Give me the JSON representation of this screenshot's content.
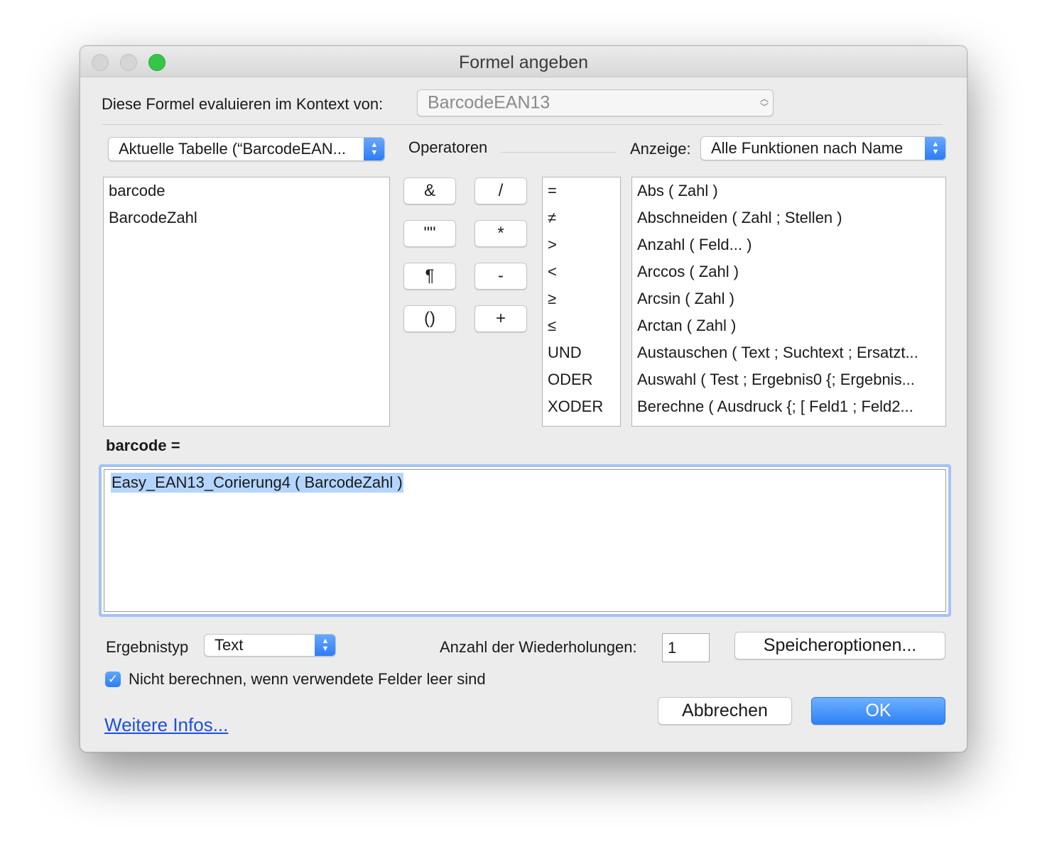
{
  "window": {
    "title": "Formel angeben"
  },
  "context": {
    "label": "Diese Formel evaluieren im Kontext von:",
    "value": "BarcodeEAN13"
  },
  "table_popup": {
    "value": "Aktuelle Tabelle (“BarcodeEAN..."
  },
  "operators_label": "Operatoren",
  "display": {
    "label": "Anzeige:",
    "value": "Alle Funktionen nach Name"
  },
  "fields": [
    "barcode",
    "BarcodeZahl"
  ],
  "operator_buttons": [
    "&",
    "/",
    "\"\"",
    "*",
    "¶",
    "-",
    "()",
    "+"
  ],
  "comparison_operators": [
    "=",
    "≠",
    ">",
    "<",
    "≥",
    "≤",
    "UND",
    "ODER",
    "XODER"
  ],
  "functions": [
    "Abs ( Zahl )",
    "Abschneiden ( Zahl ; Stellen )",
    "Anzahl ( Feld... )",
    "Arccos ( Zahl )",
    "Arcsin ( Zahl )",
    "Arctan ( Zahl )",
    "Austauschen ( Text ; Suchtext ; Ersatzt...",
    "Auswahl ( Test ; Ergebnis0 {; Ergebnis...",
    "Berechne ( Ausdruck {; [ Feld1 ; Feld2..."
  ],
  "formula": {
    "label": "barcode =",
    "text": "Easy_EAN13_Corierung4 ( BarcodeZahl )"
  },
  "result_type": {
    "label": "Ergebnistyp",
    "value": "Text"
  },
  "repetitions": {
    "label": "Anzahl der Wiederholungen:",
    "value": "1"
  },
  "storage_button": "Speicheroptionen...",
  "checkbox": {
    "label": "Nicht berechnen, wenn verwendete Felder leer sind",
    "checked": true
  },
  "more_info_link": "Weitere Infos...",
  "cancel_button": "Abbrechen",
  "ok_button": "OK",
  "colors": {
    "accent": "#2f82f4",
    "link": "#1f4fe0",
    "selection": "#b4d5fe"
  }
}
